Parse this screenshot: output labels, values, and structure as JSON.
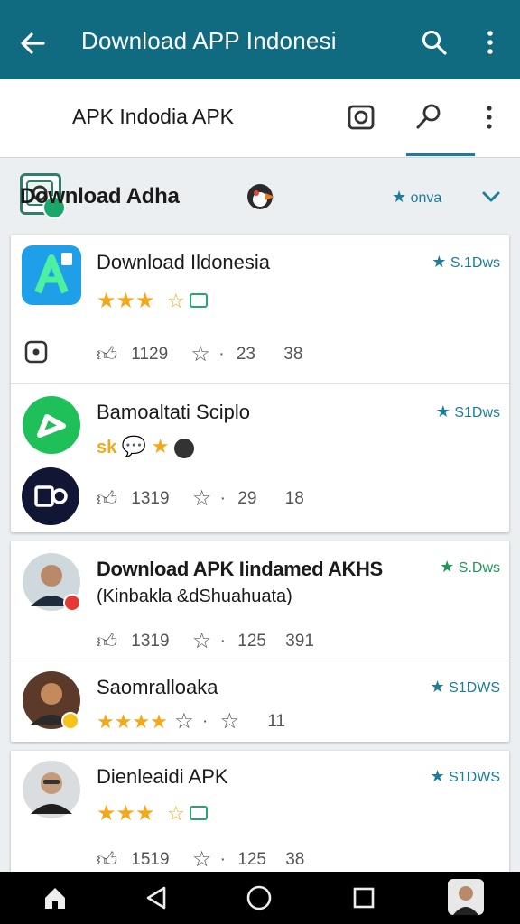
{
  "appbar": {
    "title": "Download APP Indonesi"
  },
  "subbar": {
    "name": "APK Indodia APK"
  },
  "section": {
    "heading": "Download Adha",
    "filter_label": "onva"
  },
  "items": [
    {
      "title": "Download Ildonesia",
      "badge": "S.1Dws",
      "stats": {
        "likes": "1129",
        "rating": "23",
        "count": "38"
      }
    },
    {
      "title": "Bamoaltati Sciplo",
      "badge": "S1Dws",
      "tag": "sk",
      "stats": {
        "likes": "1319",
        "rating": "29",
        "count": "18"
      }
    },
    {
      "title": "Download APK Iindamed AKHS",
      "subtitle": "(Kinbakla &dShuahuata)",
      "badge": "S.Dws",
      "stats": {
        "likes": "1319",
        "rating": "125",
        "count": "391"
      }
    },
    {
      "title": "Saomralloaka",
      "badge": "S1DWS",
      "stats": {
        "rating": "",
        "count": "11"
      }
    },
    {
      "title": "Dienleaidi APK",
      "badge": "S1DWS",
      "stats": {
        "likes": "1519",
        "rating": "125",
        "count": "38"
      }
    }
  ],
  "icons": {
    "appbar": [
      "back-arrow-icon",
      "search-icon",
      "more-vert-icon"
    ],
    "subbar": [
      "app-logo-icon",
      "camera-icon",
      "search-icon",
      "more-vert-icon"
    ],
    "nav": [
      "home-icon",
      "back-triangle-icon",
      "circle-home-icon",
      "square-recents-icon",
      "avatar"
    ]
  },
  "colors": {
    "primary": "#106a80",
    "accent": "#1b7d99",
    "star": "#f3a81a",
    "green": "#1aa86a"
  }
}
